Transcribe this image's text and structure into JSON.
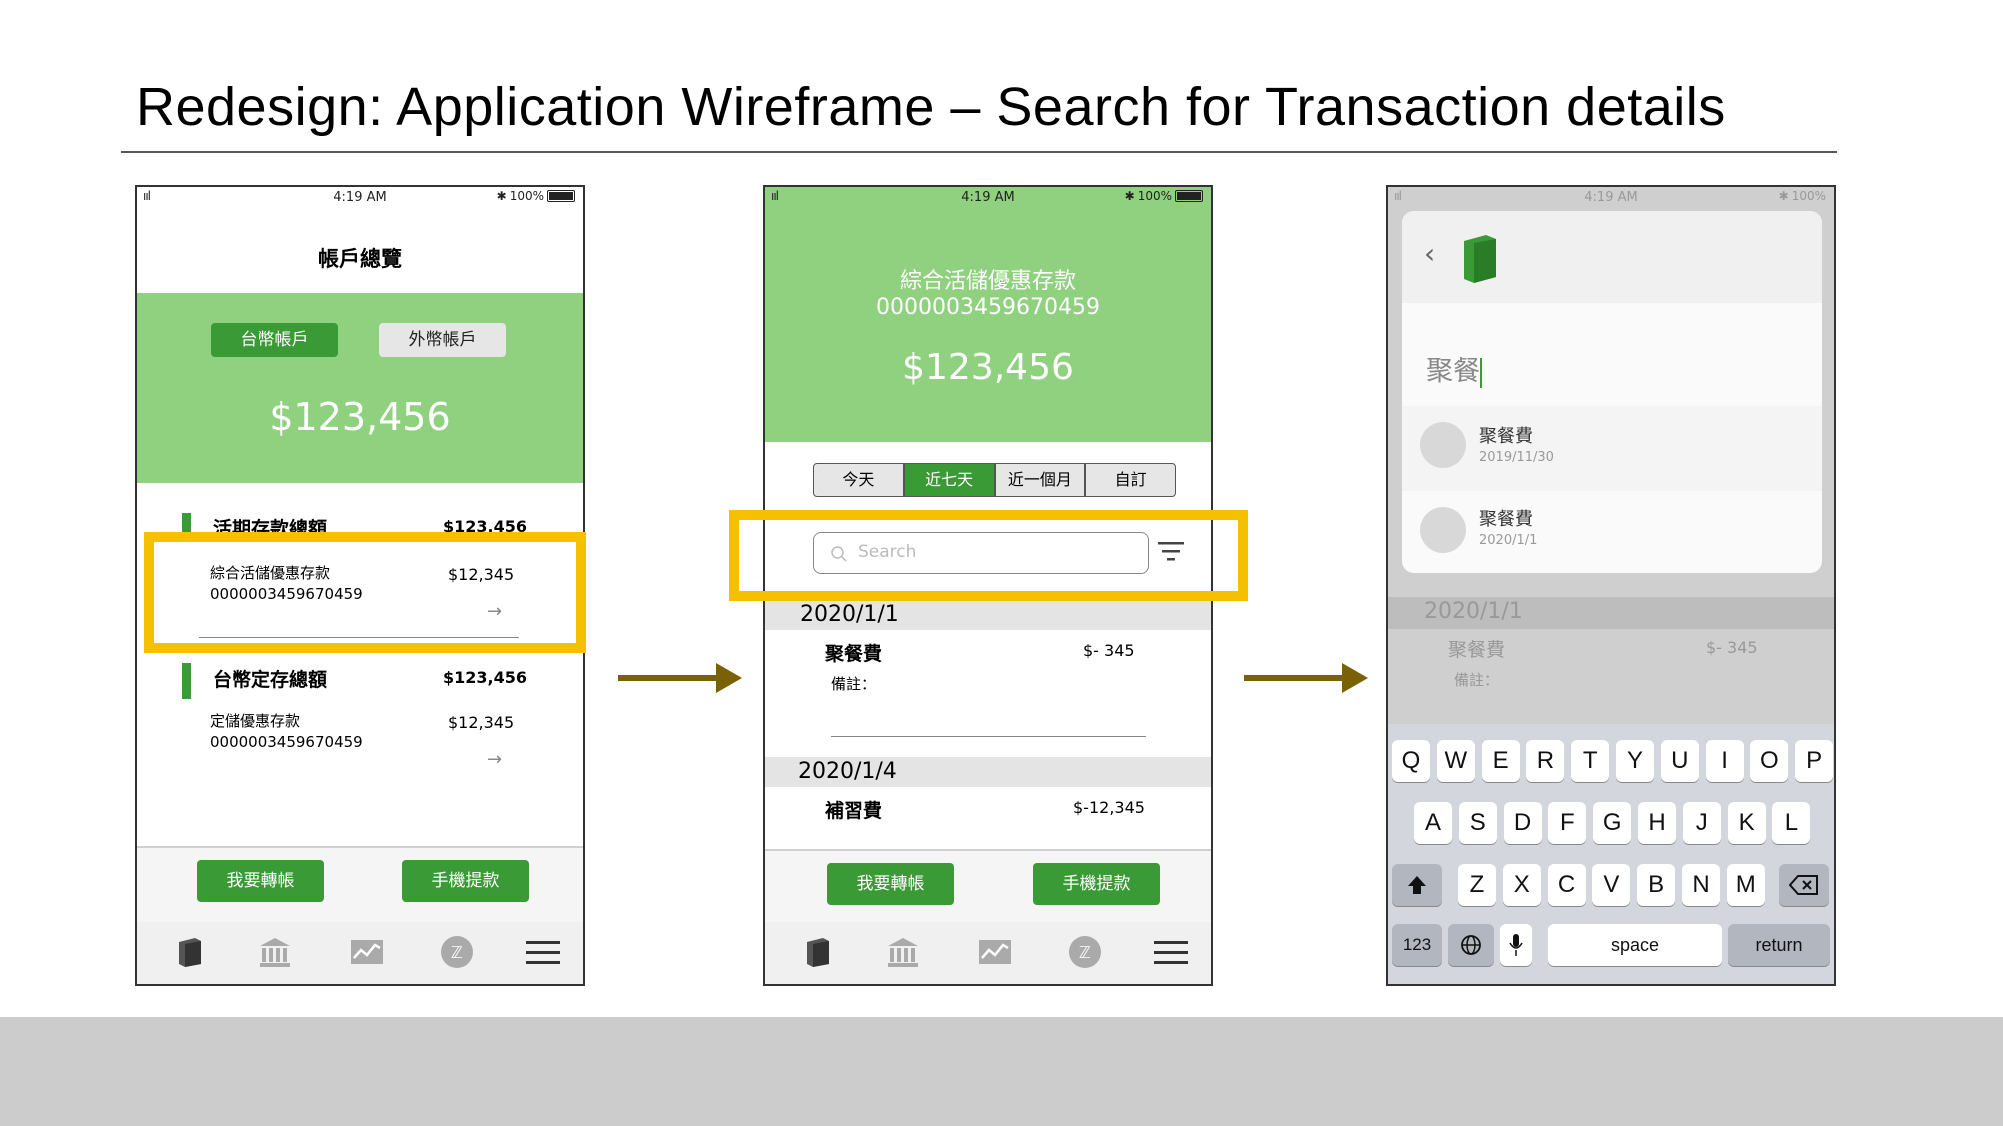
{
  "slide": {
    "title": "Redesign: Application Wireframe – Search for Transaction details"
  },
  "status_bar": {
    "time": "4:19 AM",
    "battery": "100%",
    "signal": "ııl"
  },
  "phone1": {
    "header_title": "帳戶總覽",
    "tab_twd": "台幣帳戶",
    "tab_foreign": "外幣帳戶",
    "balance": "$123,456",
    "section1": {
      "title": "活期存款總額",
      "amount": "$123,456",
      "item_name": "綜合活儲優惠存款",
      "item_number": "0000003459670459",
      "item_amount": "$12,345"
    },
    "section2": {
      "title": "台幣定存總額",
      "amount": "$123,456",
      "item_name": "定儲優惠存款",
      "item_number": "0000003459670459",
      "item_amount": "$12,345"
    },
    "transfer_button": "我要轉帳",
    "withdraw_button": "手機提款"
  },
  "phone2": {
    "account_name": "綜合活儲優惠存款",
    "account_number": "0000003459670459",
    "balance": "$123,456",
    "filters": [
      "今天",
      "近七天",
      "近一個月",
      "自訂"
    ],
    "active_filter": 1,
    "search_placeholder": "Search",
    "groups": [
      {
        "date": "2020/1/1",
        "name": "聚餐費",
        "amount": "$- 345",
        "note_label": "備註："
      },
      {
        "date": "2020/1/4",
        "name": "補習費",
        "amount": "$-12,345"
      }
    ],
    "transfer_button": "我要轉帳",
    "withdraw_button": "手機提款"
  },
  "phone3": {
    "search_text": "聚餐",
    "suggestions": [
      {
        "name": "聚餐費",
        "date": "2019/11/30"
      },
      {
        "name": "聚餐費",
        "date": "2020/1/1"
      }
    ],
    "bg_date": "2020/1/1",
    "bg_name": "聚餐費",
    "bg_amount": "$- 345",
    "bg_note": "備註：",
    "keyboard": {
      "row1": [
        "Q",
        "W",
        "E",
        "R",
        "T",
        "Y",
        "U",
        "I",
        "O",
        "P"
      ],
      "row2": [
        "A",
        "S",
        "D",
        "F",
        "G",
        "H",
        "J",
        "K",
        "L"
      ],
      "row3": [
        "Z",
        "X",
        "C",
        "V",
        "B",
        "N",
        "M"
      ],
      "numbers_key": "123",
      "space_key": "space",
      "return_key": "return"
    }
  },
  "colors": {
    "green_header": "#8fd17f",
    "green_button": "#3a9a35",
    "highlight": "#f5c000",
    "arrow": "#7b6106"
  },
  "icons": [
    "wallet-icon",
    "bank-icon",
    "chart-icon",
    "zeta-coin-icon",
    "menu-icon",
    "search-icon",
    "filter-icon",
    "back-icon",
    "shift-icon",
    "backspace-icon",
    "globe-icon",
    "mic-icon"
  ]
}
